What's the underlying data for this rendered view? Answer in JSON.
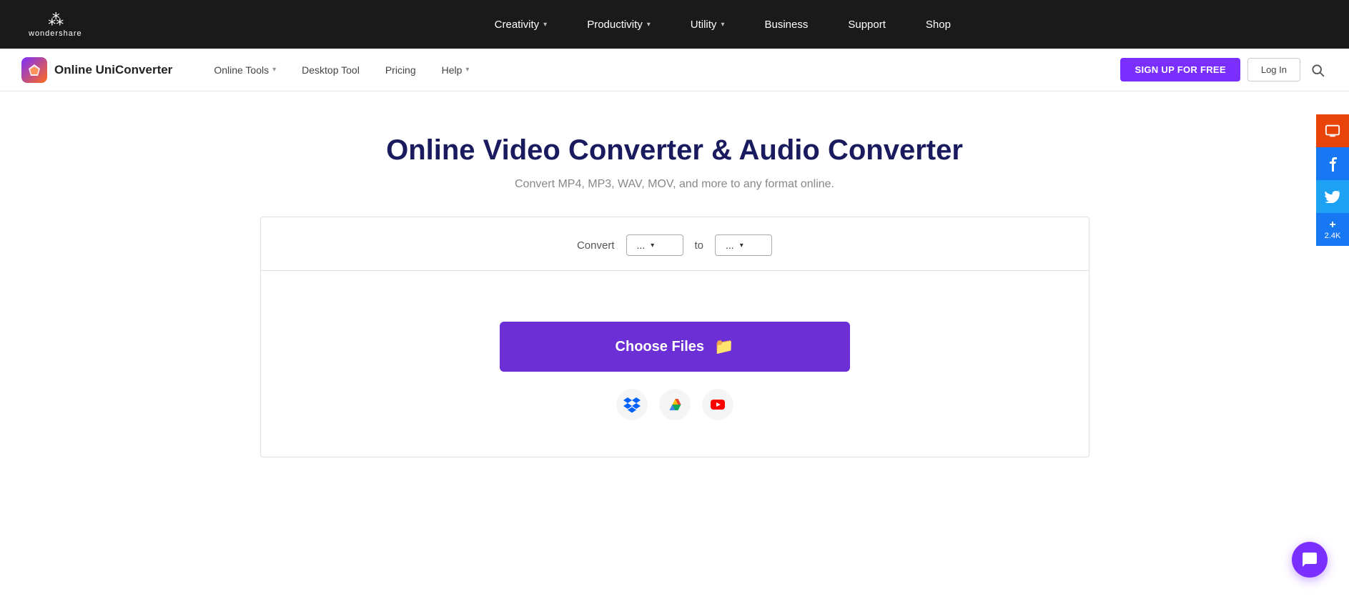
{
  "topNav": {
    "logo": {
      "icon": "❋❋",
      "text": "wondershare"
    },
    "items": [
      {
        "label": "Creativity",
        "hasDropdown": true
      },
      {
        "label": "Productivity",
        "hasDropdown": true
      },
      {
        "label": "Utility",
        "hasDropdown": true
      },
      {
        "label": "Business",
        "hasDropdown": false
      },
      {
        "label": "Support",
        "hasDropdown": false
      },
      {
        "label": "Shop",
        "hasDropdown": false
      }
    ]
  },
  "secondaryNav": {
    "brand": {
      "name": "Online UniConverter"
    },
    "items": [
      {
        "label": "Online Tools",
        "hasDropdown": true
      },
      {
        "label": "Desktop Tool",
        "hasDropdown": false
      },
      {
        "label": "Pricing",
        "hasDropdown": false
      },
      {
        "label": "Help",
        "hasDropdown": true
      }
    ],
    "signupLabel": "SIGN UP FOR FREE",
    "loginLabel": "Log In"
  },
  "main": {
    "title": "Online Video Converter & Audio Converter",
    "subtitle": "Convert MP4, MP3, WAV, MOV, and more to any format online.",
    "convert": {
      "label": "Convert",
      "fromPlaceholder": "...",
      "toLabel": "to",
      "toPlaceholder": "..."
    },
    "upload": {
      "chooseFilesLabel": "Choose Files",
      "folderIcon": "📁",
      "cloudServices": [
        {
          "name": "dropbox",
          "icon": "💧",
          "color": "#0061ff"
        },
        {
          "name": "google-drive",
          "icon": "▲",
          "color": "#fbbc04"
        },
        {
          "name": "youtube",
          "icon": "▶",
          "color": "#ff0000"
        }
      ]
    }
  },
  "social": {
    "screenLabel": "🖥",
    "facebookLabel": "f",
    "twitterLabel": "🐦",
    "shareLabel": "+",
    "shareCount": "2.4K"
  },
  "chat": {
    "icon": "💬"
  }
}
